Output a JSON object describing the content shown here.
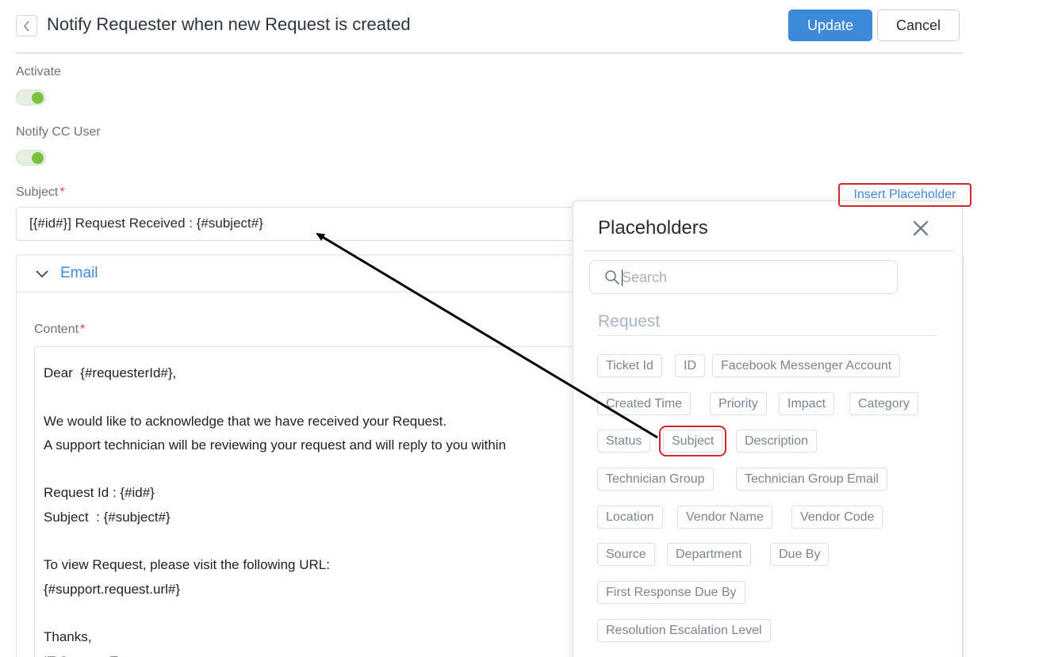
{
  "header": {
    "title": "Notify Requester when new Request is created",
    "update_label": "Update",
    "cancel_label": "Cancel"
  },
  "form": {
    "activate_label": "Activate",
    "activate_on": true,
    "notify_cc_label": "Notify CC User",
    "notify_cc_on": true,
    "subject_label": "Subject",
    "required_mark": "*",
    "subject_value": "[{#id#}] Request Received : {#subject#}",
    "insert_placeholder_label": "Insert Placeholder"
  },
  "email": {
    "section_title": "Email",
    "content_label": "Content",
    "content_lines": [
      "Dear  {#requesterId#},",
      "",
      "We would like to acknowledge that we have received your Request.",
      "A support technician will be reviewing your request and will reply to you within",
      "",
      "Request Id : {#id#}",
      "Subject  : {#subject#}",
      "",
      "To view Request, please visit the following URL:",
      "{#support.request.url#}",
      "",
      "Thanks,",
      "IT Support Team"
    ]
  },
  "placeholders": {
    "title": "Placeholders",
    "search_placeholder": "Search",
    "group": "Request",
    "chips": [
      "Ticket Id",
      "ID",
      "Facebook Messenger Account",
      "Created Time",
      "Priority",
      "Impact",
      "Category",
      "Status",
      "Subject",
      "Description",
      "Technician Group",
      "Technician Group Email",
      "Location",
      "Vendor Name",
      "Vendor Code",
      "Source",
      "Department",
      "Due By",
      "First Response Due By",
      "Resolution Escalation Level"
    ],
    "highlighted": "Subject"
  },
  "colors": {
    "accent": "#3d8ad8",
    "toggle_on": "#7ac142",
    "highlight": "#d0282e",
    "required": "#e0483c"
  }
}
